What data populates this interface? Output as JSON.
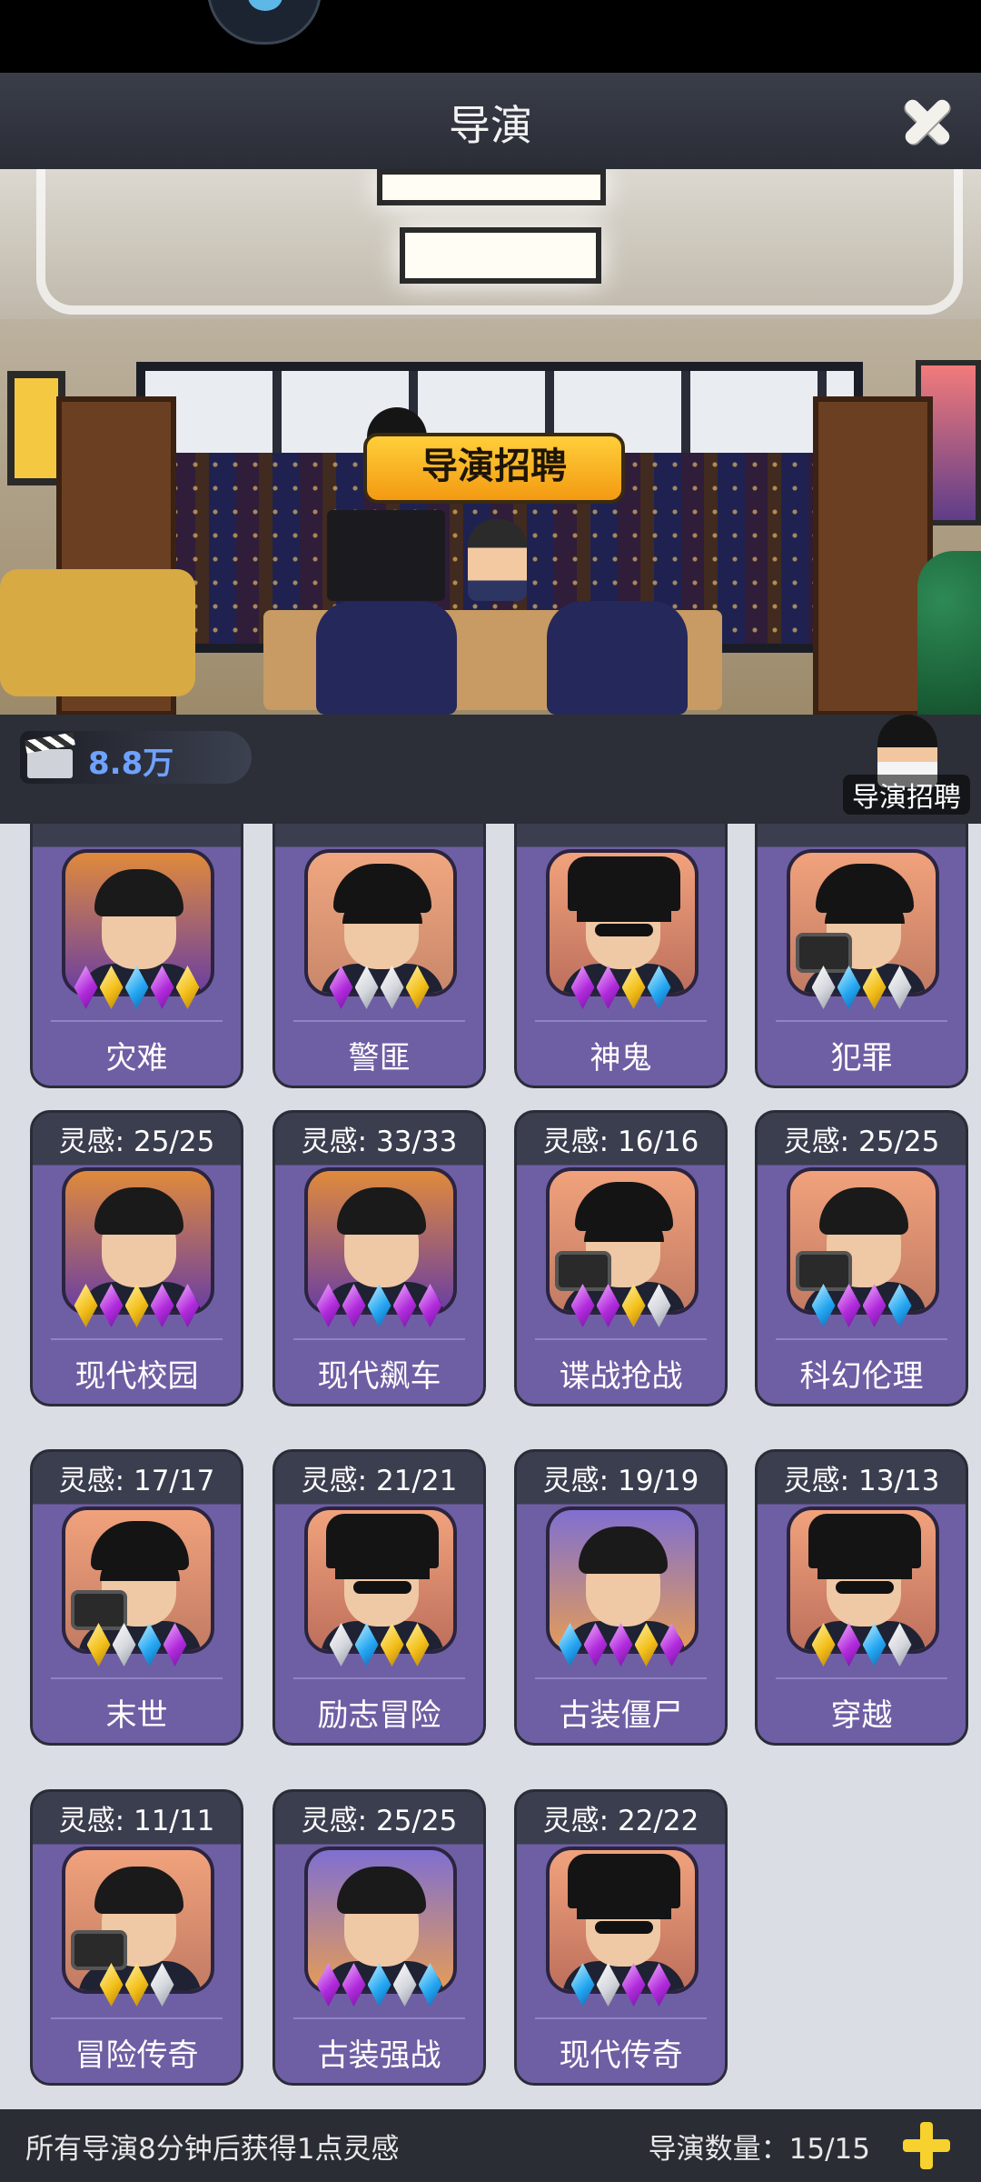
{
  "header": {
    "title": "导演"
  },
  "scene": {
    "recruit_bubble": "导演招聘"
  },
  "resources": {
    "film_value": "8.8万"
  },
  "recruit_button": {
    "label": "导演招聘"
  },
  "stamina_prefix": "灵感: ",
  "cards": [
    {
      "name": "灾难",
      "stamina": "",
      "portrait": "suit",
      "gems": [
        "purple",
        "gold",
        "blue",
        "purple",
        "gold"
      ]
    },
    {
      "name": "警匪",
      "stamina": "",
      "portrait": "cap",
      "gems": [
        "purple",
        "white",
        "white",
        "gold"
      ]
    },
    {
      "name": "神鬼",
      "stamina": "",
      "portrait": "hat",
      "gems": [
        "purple",
        "purple",
        "gold",
        "blue"
      ]
    },
    {
      "name": "犯罪",
      "stamina": "",
      "portrait": "beanie",
      "gems": [
        "white",
        "blue",
        "gold",
        "white"
      ]
    },
    {
      "name": "现代校园",
      "stamina": "灵感: 25/25",
      "portrait": "suit",
      "gems": [
        "gold",
        "purple",
        "gold",
        "purple",
        "purple"
      ]
    },
    {
      "name": "现代飙车",
      "stamina": "灵感: 33/33",
      "portrait": "suit",
      "gems": [
        "purple",
        "purple",
        "blue",
        "purple",
        "purple"
      ]
    },
    {
      "name": "谍战抢战",
      "stamina": "灵感: 16/16",
      "portrait": "beanie",
      "gems": [
        "purple",
        "purple",
        "gold",
        "white"
      ]
    },
    {
      "name": "科幻伦理",
      "stamina": "灵感: 25/25",
      "portrait": "camera",
      "gems": [
        "blue",
        "purple",
        "purple",
        "blue"
      ]
    },
    {
      "name": "末世",
      "stamina": "灵感: 17/17",
      "portrait": "beanie",
      "gems": [
        "gold",
        "white",
        "blue",
        "purple"
      ]
    },
    {
      "name": "励志冒险",
      "stamina": "灵感: 21/21",
      "portrait": "hat",
      "gems": [
        "white",
        "blue",
        "gold",
        "gold"
      ]
    },
    {
      "name": "古装僵尸",
      "stamina": "灵感: 19/19",
      "portrait": "young",
      "gems": [
        "blue",
        "purple",
        "purple",
        "gold",
        "purple"
      ]
    },
    {
      "name": "穿越",
      "stamina": "灵感: 13/13",
      "portrait": "hat",
      "gems": [
        "gold",
        "purple",
        "blue",
        "white"
      ]
    },
    {
      "name": "冒险传奇",
      "stamina": "灵感: 11/11",
      "portrait": "camera",
      "gems": [
        "gold",
        "gold",
        "white"
      ]
    },
    {
      "name": "古装强战",
      "stamina": "灵感: 25/25",
      "portrait": "young",
      "gems": [
        "purple",
        "purple",
        "blue",
        "white",
        "blue"
      ]
    },
    {
      "name": "现代传奇",
      "stamina": "灵感: 22/22",
      "portrait": "hat",
      "gems": [
        "blue",
        "white",
        "purple",
        "purple"
      ]
    }
  ],
  "footer": {
    "tip": "所有导演8分钟后获得1点灵感",
    "count": "导演数量：15/15"
  },
  "colors": {
    "card_purple": "#6e5fa4",
    "accent_gold": "#f7d22e",
    "resource_blue": "#6fa2ff"
  }
}
